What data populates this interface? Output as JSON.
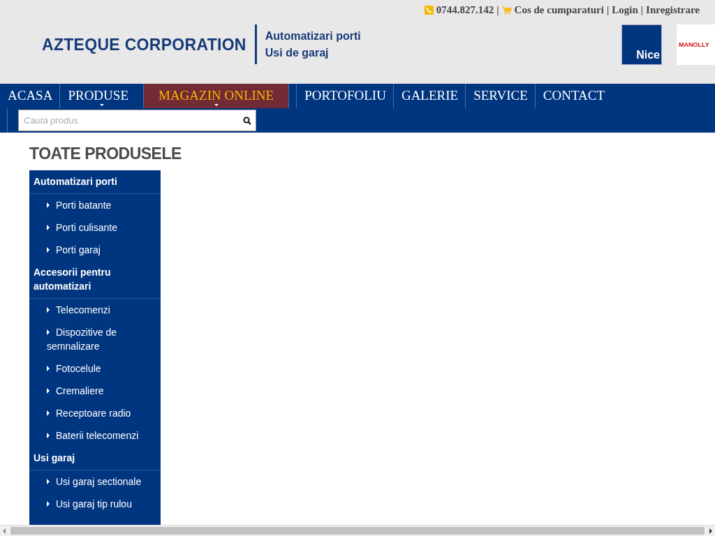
{
  "top_bar": {
    "phone": "0744.827.142",
    "separator": "|",
    "links": [
      "Cos de cumparaturi",
      "Login",
      "Inregistrare"
    ]
  },
  "logo": {
    "name": "AZTEQUE CORPORATION",
    "taglines": [
      "Automatizari porti",
      "Usi de garaj"
    ]
  },
  "brands": [
    {
      "kind": "nice",
      "label": "Nice"
    },
    {
      "kind": "manolly",
      "label": "MANOLLY"
    }
  ],
  "nav": [
    {
      "label": "ACASA",
      "selected": false,
      "dropdown": false
    },
    {
      "label": "PRODUSE",
      "selected": false,
      "dropdown": true
    },
    {
      "label": "MAGAZIN ONLINE",
      "selected": true,
      "dropdown": true
    },
    {
      "label": "PORTOFOLIU",
      "selected": false,
      "dropdown": false
    },
    {
      "label": "GALERIE",
      "selected": false,
      "dropdown": false
    },
    {
      "label": "SERVICE",
      "selected": false,
      "dropdown": false
    },
    {
      "label": "CONTACT",
      "selected": false,
      "dropdown": false
    }
  ],
  "search": {
    "placeholder": "Cauta produs"
  },
  "sidebar": {
    "title": "TOATE PRODUSELE",
    "categories": [
      {
        "label": "Automatizari porti",
        "children": [
          {
            "label": "Porti batante"
          },
          {
            "label": "Porti culisante"
          },
          {
            "label": "Porti garaj"
          }
        ]
      },
      {
        "label": "Accesorii pentru automatizari",
        "children": [
          {
            "label": "Telecomenzi"
          },
          {
            "label": "Dispozitive de semnalizare"
          },
          {
            "label": "Fotocelule"
          },
          {
            "label": "Cremaliere"
          },
          {
            "label": "Receptoare radio"
          },
          {
            "label": "Baterii telecomenzi"
          }
        ]
      },
      {
        "label": "Usi garaj",
        "children": [
          {
            "label": "Usi garaj sectionale"
          },
          {
            "label": "Usi garaj tip rulou"
          }
        ]
      }
    ]
  }
}
